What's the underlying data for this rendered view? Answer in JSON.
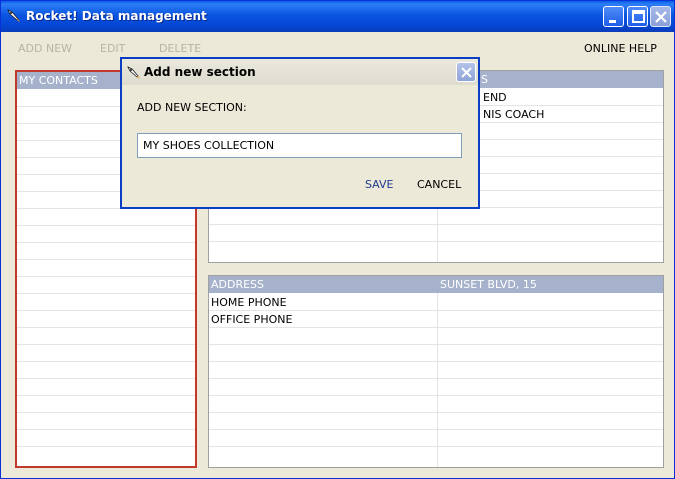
{
  "window": {
    "title": "Rocket! Data management",
    "icons": {
      "app": "rocket-icon",
      "minimize": "minimize-icon",
      "maximize": "maximize-icon",
      "close": "close-icon"
    }
  },
  "menu": {
    "add_new": "ADD NEW",
    "edit": "EDIT",
    "delete": "DELETE",
    "online_help": "ONLINE HELP"
  },
  "contacts_panel": {
    "header": "MY CONTACTS"
  },
  "top_right_panel": {
    "header_right": "S",
    "rows": [
      {
        "right": "END"
      },
      {
        "right": "NIS COACH"
      }
    ]
  },
  "bottom_right_panel": {
    "header_left": "ADDRESS",
    "header_right": "SUNSET BLVD, 15",
    "rows": [
      {
        "left": "HOME PHONE",
        "right": ""
      },
      {
        "left": "OFFICE PHONE",
        "right": ""
      }
    ]
  },
  "dialog": {
    "title": "Add new section",
    "label": "ADD NEW SECTION:",
    "input_value": "MY SHOES COLLECTION",
    "save": "SAVE",
    "cancel": "CANCEL",
    "colors": {
      "border": "#0a3fc4",
      "save_text": "#1f3a8f"
    }
  },
  "colors": {
    "titlebar": "#0b55e1",
    "header_row": "#a6b2cb",
    "contacts_border": "#c0392b",
    "disabled_menu": "#b7b4a5"
  }
}
